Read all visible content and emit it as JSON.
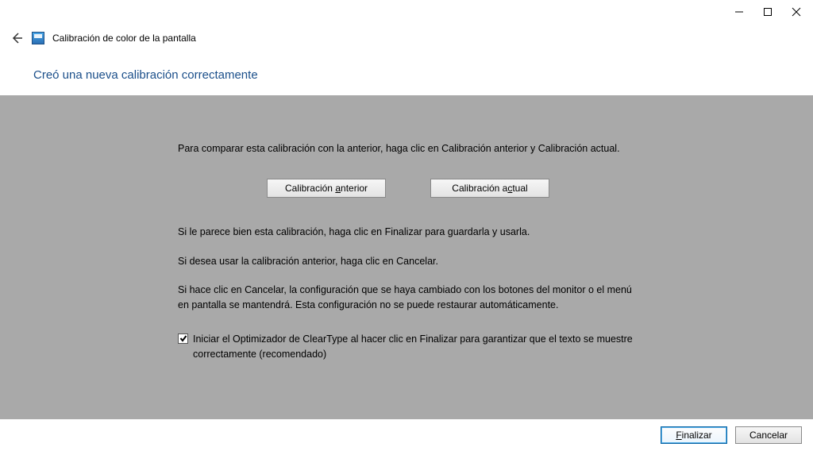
{
  "window": {
    "app_title": "Calibración de color de la pantalla"
  },
  "heading": "Creó una nueva calibración correctamente",
  "body": {
    "compare_text": "Para comparar esta calibración con la anterior, haga clic en Calibración anterior y Calibración actual.",
    "prev_btn_pre": "Calibración ",
    "prev_btn_ul": "a",
    "prev_btn_post": "nterior",
    "curr_btn_pre": "Calibración a",
    "curr_btn_ul": "c",
    "curr_btn_post": "tual",
    "ok_text": "Si le parece bien esta calibración, haga clic en Finalizar para guardarla y usarla.",
    "cancel_text": "Si desea usar la calibración anterior, haga clic en Cancelar.",
    "note_text": "Si hace clic en Cancelar, la configuración que se haya cambiado con los botones del monitor o el menú en pantalla se mantendrá. Esta configuración no se puede restaurar automáticamente.",
    "cleartype_pre": "",
    "cleartype_ul": "I",
    "cleartype_post": "niciar el Optimizador de ClearType al hacer clic en Finalizar para garantizar que el texto se muestre correctamente (recomendado)"
  },
  "footer": {
    "finish_ul": "F",
    "finish_post": "inalizar",
    "cancel": "Cancelar"
  }
}
